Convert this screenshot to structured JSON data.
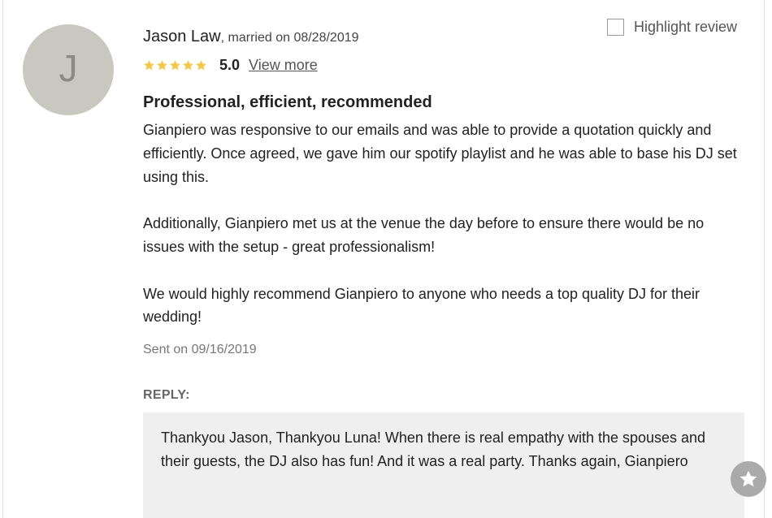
{
  "review": {
    "avatar_initial": "J",
    "author_name": "Jason Law",
    "married_text": ", married on 08/28/2019",
    "rating": 5.0,
    "rating_text": "5.0",
    "view_more_label": "View more",
    "highlight_label": "Highlight review",
    "highlight_checked": false,
    "title": "Professional, efficient, recommended",
    "body": {
      "p1": "Gianpiero was responsive to our emails and was able to provide a quotation quickly and efficiently. Once agreed, we gave him our spotify playlist and he was able to base his DJ set using this.",
      "p2": "Additionally, Gianpiero met us at the venue the day before to ensure there would be no issues with the setup - great professionalism!",
      "p3": "We would highly recommend Gianpiero to anyone who needs a top quality DJ for their wedding!"
    },
    "sent_text": "Sent on 09/16/2019"
  },
  "reply": {
    "label": "REPLY:",
    "text": "Thankyou Jason, Thankyou Luna! When there is real empathy with the spouses and their guests, the DJ also has fun! And it was a real party. Thanks again, Gianpiero"
  },
  "icons": {
    "rating_star": "star-icon",
    "favorite_button": "star-badge-icon"
  },
  "colors": {
    "star": "#f2c94c",
    "avatar_bg": "#c8c8c1",
    "reply_bg": "#efefef",
    "fav_button_bg": "#aaaaaa"
  }
}
